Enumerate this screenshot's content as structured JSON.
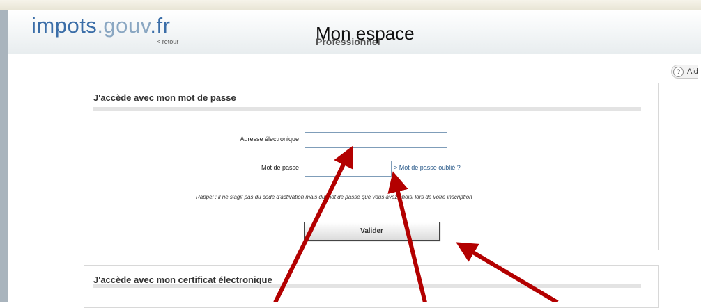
{
  "header": {
    "logo_part1": "impots",
    "logo_part2": ".gouv",
    "logo_part3": ".fr",
    "retour": "< retour",
    "title": "Mon espace",
    "subtitle": "Professionnel"
  },
  "help": {
    "label": "Aid"
  },
  "login": {
    "title": "J'accède avec mon mot de passe",
    "email_label": "Adresse électronique",
    "email_value": "",
    "password_label": "Mot de passe",
    "password_value": "",
    "forgot": "> Mot de passe oublié ?",
    "rappel_before": "Rappel : il ",
    "rappel_underlined": "ne s'agit pas du code d'activation",
    "rappel_after": " mais du mot de passe que vous avez choisi lors de votre inscription",
    "submit": "Valider"
  },
  "certificate": {
    "title": "J'accède avec mon certificat électronique"
  },
  "colors": {
    "arrow": "#b30000",
    "logo": "#3b6ea8"
  }
}
